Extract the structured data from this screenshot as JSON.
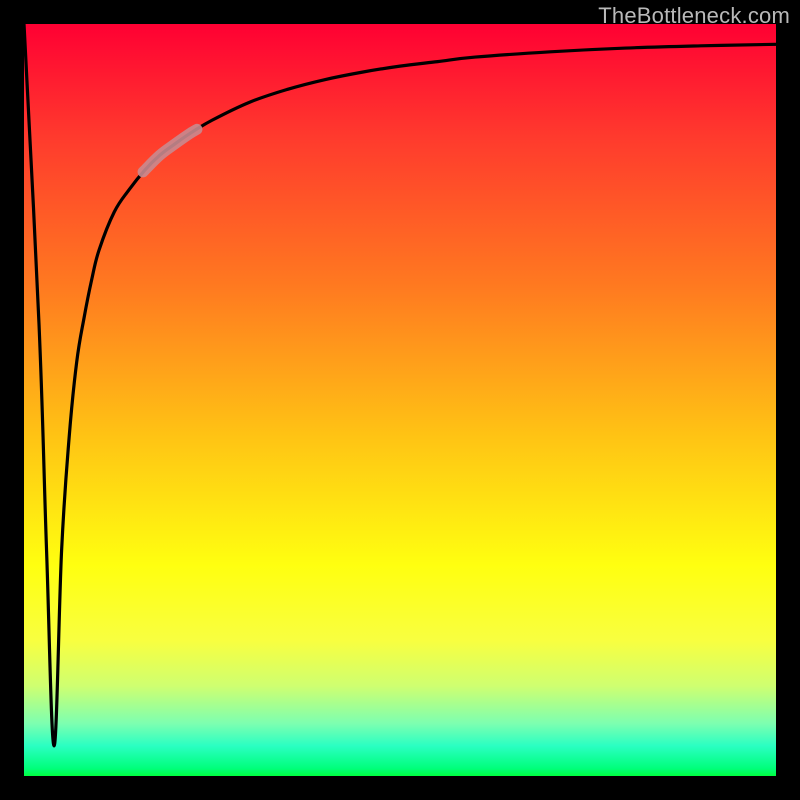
{
  "attribution": "TheBottleneck.com",
  "chart_data": {
    "type": "line",
    "title": "",
    "xlabel": "",
    "ylabel": "",
    "x_range": [
      0,
      100
    ],
    "y_range": [
      0,
      100
    ],
    "notch": {
      "x": 4,
      "y_bottom": 4
    },
    "plateau": {
      "y_right": 97
    },
    "highlight_segment": {
      "x_start": 16,
      "x_end": 23
    },
    "series": [
      {
        "name": "bottleneck-curve",
        "x": [
          0,
          2,
          3,
          4,
          5,
          6,
          7,
          8,
          9,
          10,
          12,
          14,
          16,
          18,
          20,
          22,
          25,
          30,
          35,
          40,
          45,
          50,
          55,
          60,
          70,
          80,
          90,
          100
        ],
        "y": [
          100,
          60,
          30,
          4,
          30,
          45,
          55,
          61,
          66,
          70,
          75,
          78,
          80.5,
          82.5,
          84,
          85.4,
          87.2,
          89.6,
          91.3,
          92.6,
          93.6,
          94.4,
          95.0,
          95.6,
          96.3,
          96.8,
          97.1,
          97.3
        ]
      }
    ]
  }
}
